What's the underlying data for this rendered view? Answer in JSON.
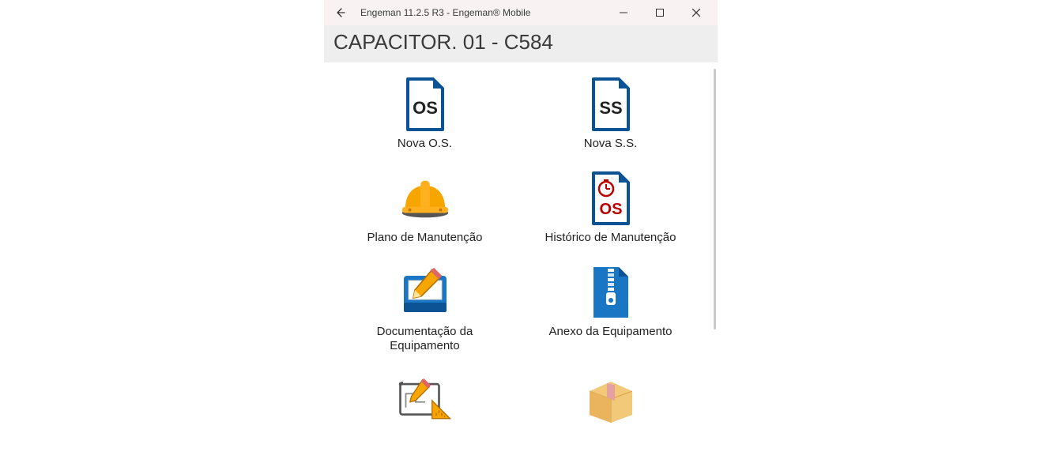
{
  "window": {
    "title": "Engeman 11.2.5 R3 - Engeman® Mobile"
  },
  "header": {
    "title": "CAPACITOR. 01 - C584"
  },
  "tiles": [
    {
      "label": "Nova O.S."
    },
    {
      "label": "Nova S.S."
    },
    {
      "label": "Plano de Manutenção"
    },
    {
      "label": "Histórico de Manutenção"
    },
    {
      "label": "Documentação da Equipamento"
    },
    {
      "label": "Anexo da Equipamento"
    },
    {
      "label": ""
    },
    {
      "label": ""
    }
  ]
}
